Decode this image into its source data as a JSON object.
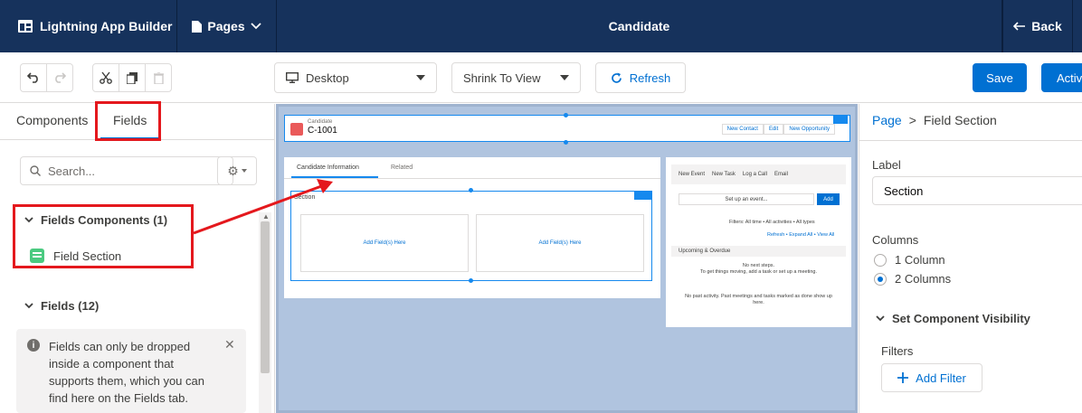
{
  "topbar": {
    "app_title": "Lightning App Builder",
    "pages_label": "Pages",
    "page_name": "Candidate",
    "back_label": "Back"
  },
  "toolbar": {
    "device_select": "Desktop",
    "view_select": "Shrink To View",
    "refresh_label": "Refresh",
    "save_label": "Save",
    "activate_label": "Activ"
  },
  "left_panel": {
    "tabs": [
      "Components",
      "Fields"
    ],
    "active_tab": "Fields",
    "search_placeholder": "Search...",
    "fields_components_heading": "Fields Components (1)",
    "field_section_item": "Field Section",
    "fields_heading": "Fields (12)",
    "info_lines": [
      "Fields can only be dropped",
      "inside a component that",
      "supports them, which you can",
      "find here on the Fields tab."
    ]
  },
  "canvas": {
    "record_label": "Candidate",
    "record_name": "C-1001",
    "header_buttons": [
      "New Contact",
      "Edit",
      "New Opportunity"
    ],
    "tabs": [
      "Candidate Information",
      "Related"
    ],
    "section_label": "Section",
    "drop_text": "Add Field(s) Here",
    "activity_tabs": [
      "New Event",
      "New Task",
      "Log a Call",
      "Email"
    ],
    "event_placeholder": "Set up an event...",
    "add_label": "Add",
    "filters_text": "Filters: All time • All activities • All types",
    "refresh_links": "Refresh • Expand All • View All",
    "upcoming_label": "Upcoming & Overdue",
    "no_next_steps": "No next steps.",
    "no_next_steps_hint": "To get things moving, add a task or set up a meeting.",
    "no_past_activity": "No past activity. Past meetings and tasks marked as done show up",
    "no_past_activity_2": "here."
  },
  "right_panel": {
    "breadcrumb_link": "Page",
    "breadcrumb_current": "Field Section",
    "label_heading": "Label",
    "label_value": "Section",
    "columns_heading": "Columns",
    "column_options": [
      "1 Column",
      "2 Columns"
    ],
    "selected_column": "2 Columns",
    "visibility_heading": "Set Component Visibility",
    "filters_heading": "Filters",
    "add_filter_label": "Add Filter"
  },
  "colors": {
    "nav_bg": "#16325c",
    "brand_blue": "#0070d2",
    "canvas_bg": "#b0c4df",
    "annotation_red": "#e4181d",
    "field_section_green": "#4bca81"
  }
}
